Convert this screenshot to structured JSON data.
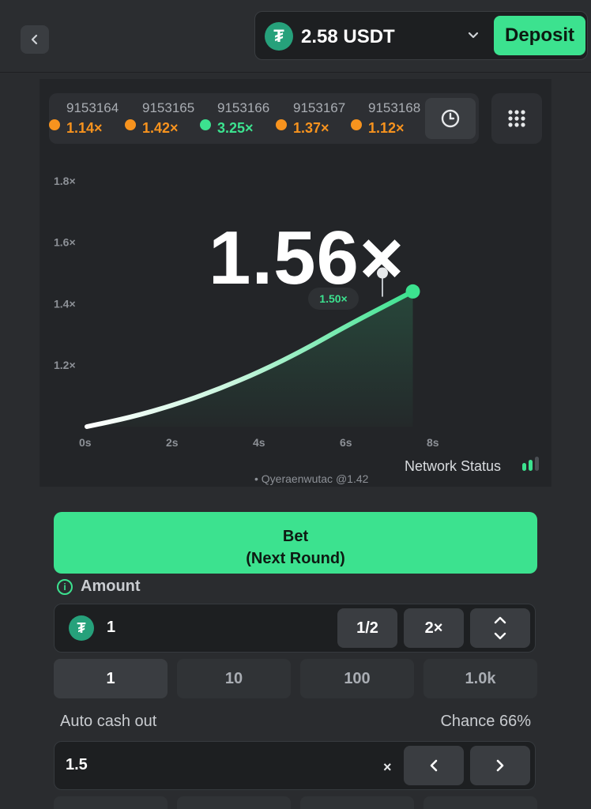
{
  "wallet": {
    "balance": "2.58 USDT",
    "currency_icon": "tether-icon",
    "deposit_label": "Deposit"
  },
  "history": [
    {
      "round": "9153164",
      "multiplier": "1.14×",
      "color": "#f7931e"
    },
    {
      "round": "9153165",
      "multiplier": "1.42×",
      "color": "#f7931e"
    },
    {
      "round": "9153166",
      "multiplier": "3.25×",
      "color": "#3ce28f"
    },
    {
      "round": "9153167",
      "multiplier": "1.37×",
      "color": "#f7931e"
    },
    {
      "round": "9153168",
      "multiplier": "1.12×",
      "color": "#f7931e"
    }
  ],
  "game": {
    "current_multiplier": "1.56×",
    "cashout_marker": "1.50×",
    "network_status_label": "Network Status",
    "ticker_text": "• Qyeraenwutac @1.42"
  },
  "chart_data": {
    "type": "line",
    "x_ticks": [
      "0s",
      "2s",
      "4s",
      "6s",
      "8s"
    ],
    "y_ticks": [
      "1.2×",
      "1.4×",
      "1.6×",
      "1.8×"
    ],
    "xlim": [
      0,
      8
    ],
    "ylim": [
      1.0,
      1.9
    ],
    "series": [
      {
        "x": [
          0,
          1,
          2,
          3,
          4,
          5,
          6,
          7.5
        ],
        "values": [
          1.0,
          1.03,
          1.07,
          1.12,
          1.18,
          1.25,
          1.33,
          1.44
        ]
      }
    ],
    "cashout_point": {
      "x": 6.8,
      "y": 1.5
    },
    "line_color": "#3ce28f"
  },
  "bet": {
    "label_line1": "Bet",
    "label_line2": "(Next Round)"
  },
  "amount": {
    "label": "Amount",
    "value": "1",
    "half_label": "1/2",
    "double_label": "2×",
    "presets": [
      "1",
      "10",
      "100",
      "1.0k"
    ]
  },
  "auto_cashout": {
    "label": "Auto cash out",
    "chance": "Chance 66%",
    "value": "1.5",
    "suffix": "×"
  }
}
